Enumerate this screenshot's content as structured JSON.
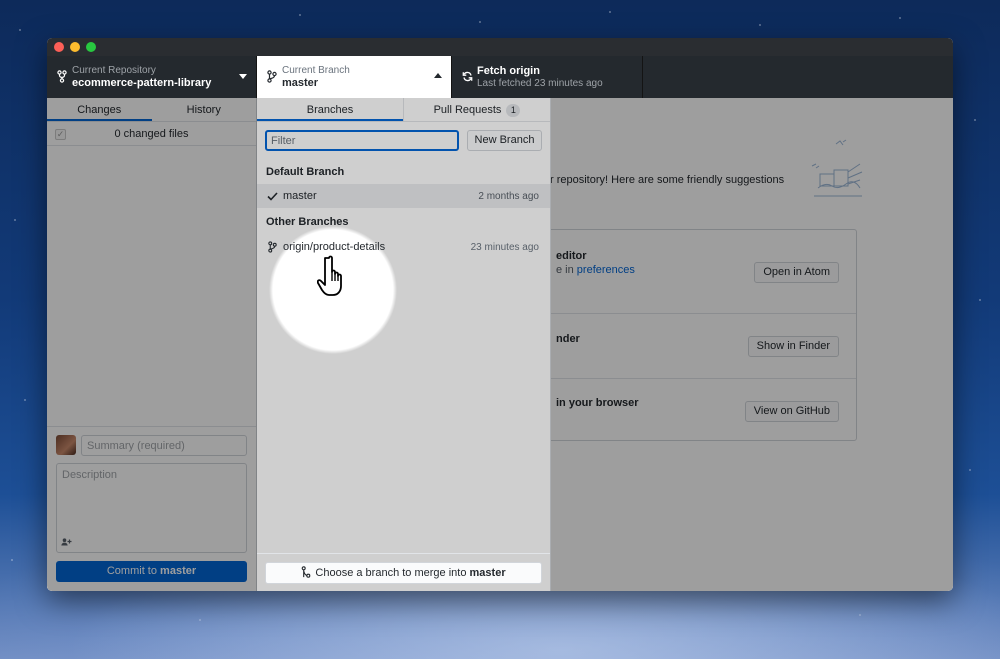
{
  "toolbar": {
    "repo": {
      "label": "Current Repository",
      "value": "ecommerce-pattern-library",
      "icon": "repo-icon"
    },
    "branch": {
      "label": "Current Branch",
      "value": "master",
      "icon": "branch-icon"
    },
    "fetch": {
      "label": "Fetch origin",
      "sub": "Last fetched 23 minutes ago",
      "icon": "sync-icon"
    }
  },
  "sidebar": {
    "tabs": [
      "Changes",
      "History"
    ],
    "changed_files": "0 changed files",
    "summary_placeholder": "Summary (required)",
    "description_placeholder": "Description",
    "commit_prefix": "Commit to",
    "commit_branch": "master"
  },
  "main": {
    "blank_text": "r repository! Here are some friendly suggestions",
    "rows": [
      {
        "title": "editor",
        "sub_prefix": "e in ",
        "link": "preferences",
        "button": "Open in Atom"
      },
      {
        "title": "nder",
        "button": "Show in Finder"
      },
      {
        "title": "in your browser",
        "button": "View on GitHub"
      }
    ]
  },
  "dropdown": {
    "tabs": {
      "branches": "Branches",
      "pull_requests": "Pull Requests",
      "pr_count": "1"
    },
    "filter_placeholder": "Filter",
    "new_branch": "New Branch",
    "default_header": "Default Branch",
    "default_branches": [
      {
        "name": "master",
        "time": "2 months ago",
        "icon": "check-icon"
      }
    ],
    "other_header": "Other Branches",
    "other_branches": [
      {
        "name": "origin/product-details",
        "time": "23 minutes ago",
        "icon": "branch-icon"
      }
    ],
    "merge_prefix": "Choose a branch to merge into",
    "merge_branch": "master"
  },
  "colors": {
    "accent": "#0366d6",
    "toolbar_bg": "#24292e"
  }
}
